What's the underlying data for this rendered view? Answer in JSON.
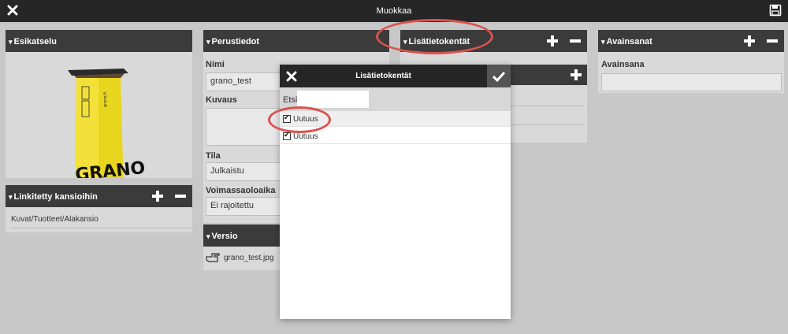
{
  "topbar": {
    "title": "Muokkaa",
    "close_icon": "close-icon",
    "save_icon": "save-icon"
  },
  "preview": {
    "header": "Esikatselu",
    "product_text": [
      "GRANO",
      "grano.fi"
    ]
  },
  "linked_folders": {
    "header": "Linkitetty kansioihin",
    "items": [
      "Kuvat/Tuotteet/Alakansio"
    ]
  },
  "basic_info": {
    "header": "Perustiedot",
    "name_label": "Nimi",
    "name_value": "grano_test",
    "description_label": "Kuvaus",
    "description_value": "",
    "status_label": "Tila",
    "status_value": "Julkaistu",
    "validity_label": "Voimassaoloaika",
    "validity_value": "Ei rajoitettu"
  },
  "version": {
    "header": "Versio",
    "file": "grano_test.jpg"
  },
  "extra_fields": {
    "header": "Lisätietokentät"
  },
  "keywords": {
    "header": "Avainsanat",
    "field_label": "Avainsana",
    "field_value": ""
  },
  "modal": {
    "title": "Lisätietokentät",
    "search_label": "Etsi",
    "search_value": "",
    "rows": [
      {
        "label": "Uutuus",
        "checked": true,
        "highlighted": true
      },
      {
        "label": "Uutuus",
        "checked": true,
        "highlighted": false
      }
    ]
  },
  "colors": {
    "dark": "#262626",
    "panel_header": "#3b3b3b",
    "background": "#c8c8c8",
    "annotation": "#d9534f"
  }
}
